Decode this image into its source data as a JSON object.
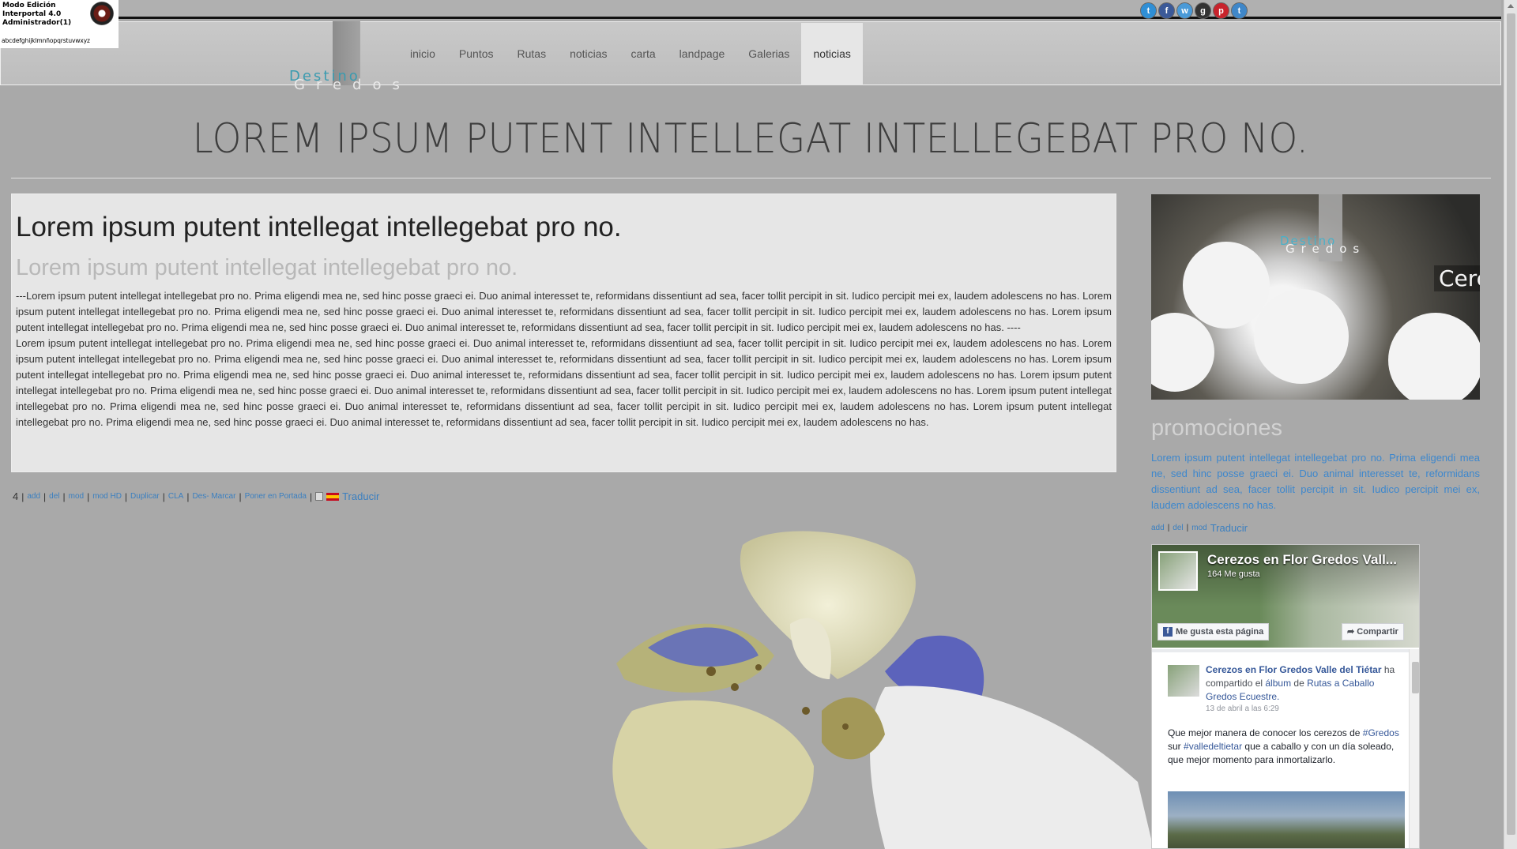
{
  "admin": {
    "line1": "Modo Edición",
    "line2": "Interportal 4.0",
    "line3": "Administrador(1)",
    "alphabet": "abcdefghijklmnñopqrstuvwxyz"
  },
  "social": [
    {
      "icon": "twitter-icon",
      "glyph": "t",
      "color": "#2f8fd6"
    },
    {
      "icon": "facebook-icon",
      "glyph": "f",
      "color": "#3b5998"
    },
    {
      "icon": "web-icon",
      "glyph": "w",
      "color": "#4a9ad8"
    },
    {
      "icon": "google-plus-icon",
      "glyph": "g",
      "color": "#333333"
    },
    {
      "icon": "pinterest-icon",
      "glyph": "p",
      "color": "#c8232c"
    },
    {
      "icon": "twitter-bird-icon",
      "glyph": "t",
      "color": "#3f87c9"
    }
  ],
  "logo": {
    "top": "Destino",
    "bottom": "Gredos"
  },
  "nav": {
    "items": [
      "inicio",
      "Puntos",
      "Rutas",
      "noticias",
      "carta",
      "landpage",
      "Galerias",
      "noticias"
    ],
    "active_index": 7
  },
  "page_title": "LOREM IPSUM PUTENT INTELLEGAT INTELLEGEBAT PRO NO.",
  "article": {
    "title": "Lorem ipsum putent intellegat intellegebat pro no.",
    "subtitle": "Lorem ipsum putent intellegat intellegebat pro no.",
    "para1": "---Lorem ipsum putent intellegat intellegebat pro no. Prima eligendi mea ne, sed hinc posse graeci ei. Duo animal interesset te, reformidans dissentiunt ad sea, facer tollit percipit in sit. Iudico percipit mei ex, laudem adolescens no has. Lorem ipsum putent intellegat intellegebat pro no. Prima eligendi mea ne, sed hinc posse graeci ei. Duo animal interesset te, reformidans dissentiunt ad sea, facer tollit percipit in sit. Iudico percipit mei ex, laudem adolescens no has. Lorem ipsum putent intellegat intellegebat pro no. Prima eligendi mea ne, sed hinc posse graeci ei. Duo animal interesset te, reformidans dissentiunt ad sea, facer tollit percipit in sit. Iudico percipit mei ex, laudem adolescens no has. ----",
    "para2": "Lorem ipsum putent intellegat intellegebat pro no. Prima eligendi mea ne, sed hinc posse graeci ei. Duo animal interesset te, reformidans dissentiunt ad sea, facer tollit percipit in sit. Iudico percipit mei ex, laudem adolescens no has. Lorem ipsum putent intellegat intellegebat pro no. Prima eligendi mea ne, sed hinc posse graeci ei. Duo animal interesset te, reformidans dissentiunt ad sea, facer tollit percipit in sit. Iudico percipit mei ex, laudem adolescens no has. Lorem ipsum putent intellegat intellegebat pro no. Prima eligendi mea ne, sed hinc posse graeci ei. Duo animal interesset te, reformidans dissentiunt ad sea, facer tollit percipit in sit. Iudico percipit mei ex, laudem adolescens no has. Lorem ipsum putent intellegat intellegebat pro no. Prima eligendi mea ne, sed hinc posse graeci ei. Duo animal interesset te, reformidans dissentiunt ad sea, facer tollit percipit in sit. Iudico percipit mei ex, laudem adolescens no has. Lorem ipsum putent intellegat intellegebat pro no. Prima eligendi mea ne, sed hinc posse graeci ei. Duo animal interesset te, reformidans dissentiunt ad sea, facer tollit percipit in sit. Iudico percipit mei ex, laudem adolescens no has. Lorem ipsum putent intellegat intellegebat pro no. Prima eligendi mea ne, sed hinc posse graeci ei. Duo animal interesset te, reformidans dissentiunt ad sea, facer tollit percipit in sit. Iudico percipit mei ex, laudem adolescens no has."
  },
  "admin_links": {
    "count": "4",
    "add": "add",
    "del": "del",
    "mod": "mod",
    "mod_hd": "mod HD",
    "duplicar": "Duplicar",
    "cla": "CLA",
    "desmarcar": "Des- Marcar",
    "portada": "Poner en Portada",
    "traducir": "Traducir"
  },
  "sidebar": {
    "image": {
      "top": "Destino",
      "bottom": "Gredos",
      "caption": "Cere"
    },
    "promo_title": "promociones",
    "promo_text": "Lorem ipsum putent intellegat intellegebat pro no. Prima eligendi mea ne, sed hinc posse graeci ei. Duo animal interesset te, reformidans dissentiunt ad sea, facer tollit percipit in sit. Iudico percipit mei ex, laudem adolescens no has.",
    "links": {
      "add": "add",
      "del": "del",
      "mod": "mod",
      "traducir": "Traducir"
    }
  },
  "facebook": {
    "page_name": "Cerezos en Flor Gredos Vall...",
    "likes": "164 Me gusta",
    "like_button": "Me gusta esta página",
    "share_button": "Compartir",
    "post": {
      "author": "Cerezos en Flor Gredos Valle del Tiétar",
      "action": " ha compartido el ",
      "object_word": "álbum",
      "connector": " de ",
      "target": "Rutas a Caballo Gredos Ecuestre.",
      "date": "13 de abril a las 6:29",
      "text1": "Que mejor manera de conocer los cerezos de ",
      "tag1": "#Gredos",
      "text2": " sur ",
      "tag2": "#valledeltietar",
      "text3": " que a caballo y con un día soleado, que mejor momento para inmortalizarlo."
    }
  },
  "colors": {
    "accent": "#3a9bb0",
    "link": "#3a7fc0",
    "background": "#a9a9a9"
  }
}
